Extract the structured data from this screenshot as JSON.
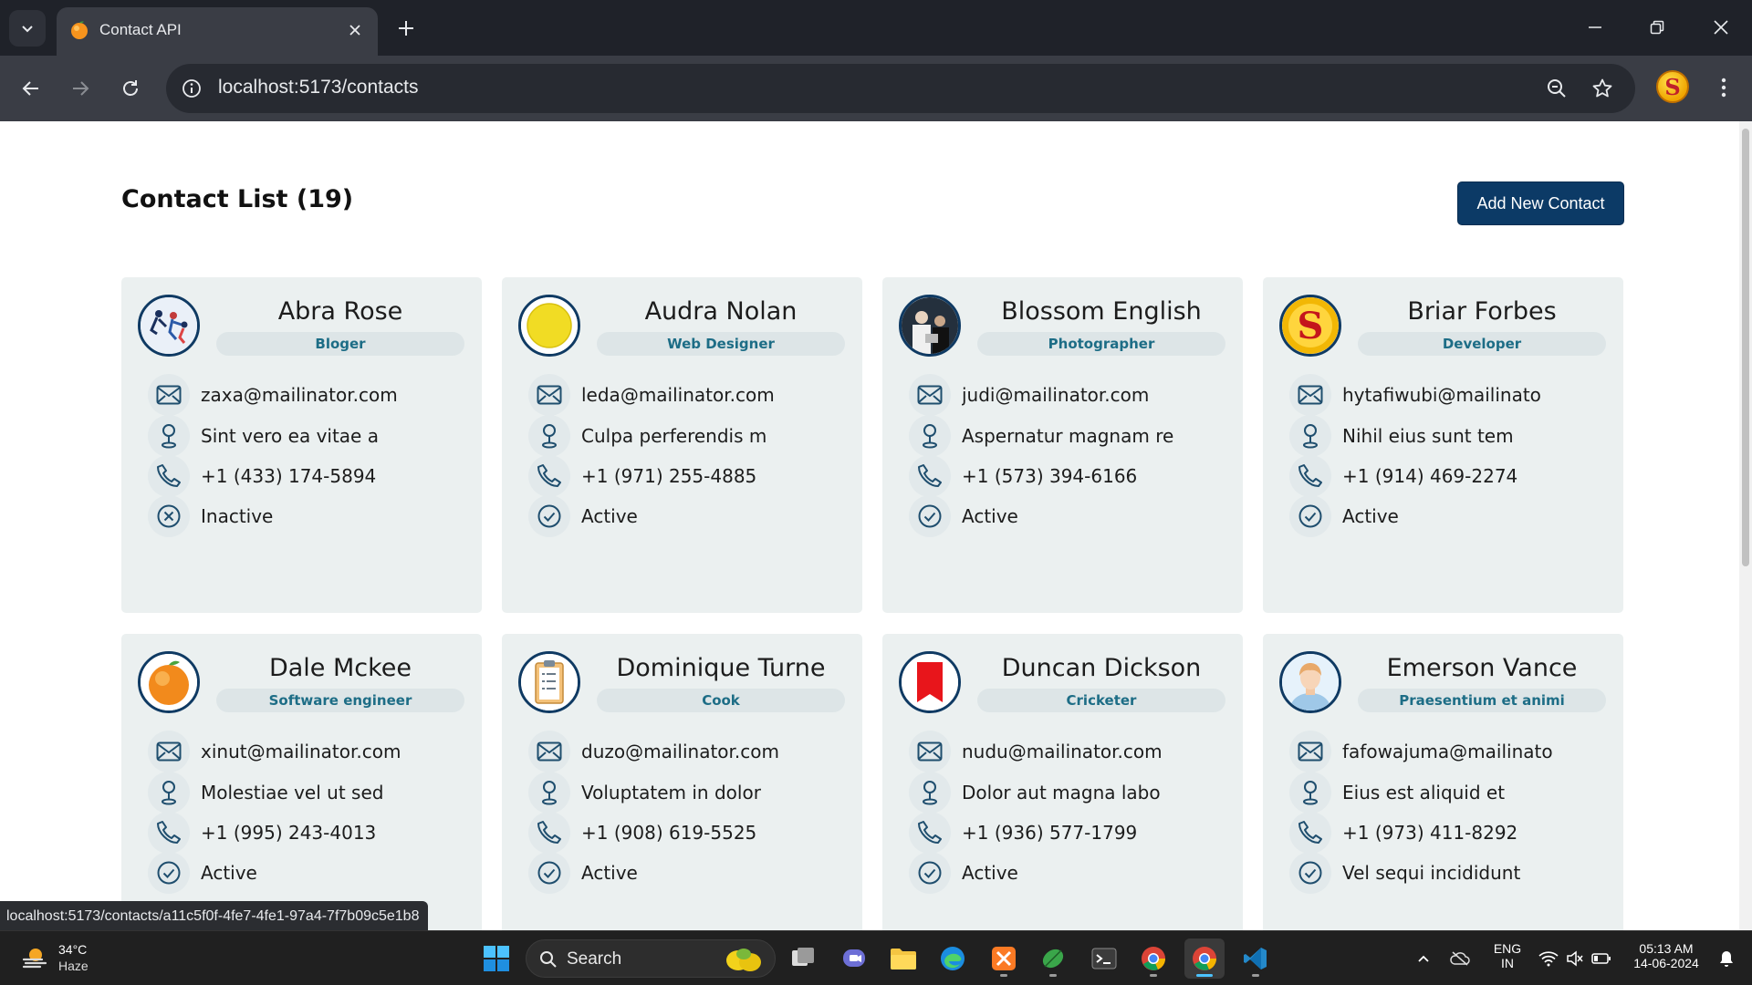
{
  "browser": {
    "tab_title": "Contact API",
    "url": "localhost:5173/contacts",
    "status_url": "localhost:5173/contacts/a11c5f0f-4fe7-4fe1-97a4-7f7b09c5e1b8"
  },
  "page": {
    "title": "Contact List (19)",
    "add_button": "Add New Contact"
  },
  "contacts": [
    {
      "name": "Abra Rose",
      "role": "Bloger",
      "email": "zaxa@mailinator.com",
      "address": "Sint vero ea vitae a",
      "phone": "+1 (433) 174-5894",
      "status": "Inactive",
      "avatar": "runners-photo"
    },
    {
      "name": "Audra Nolan",
      "role": "Web Designer",
      "email": "leda@mailinator.com",
      "address": "Culpa perferendis m",
      "phone": "+1 (971) 255-4885",
      "status": "Active",
      "avatar": "yellow-circle"
    },
    {
      "name": "Blossom English",
      "role": "Photographer",
      "email": "judi@mailinator.com",
      "address": "Aspernatur magnam re",
      "phone": "+1 (573) 394-6166",
      "status": "Active",
      "avatar": "people-photo"
    },
    {
      "name": "Briar Forbes",
      "role": "Developer",
      "email": "hytafiwubi@mailinato",
      "address": "Nihil eius sunt tem",
      "phone": "+1 (914) 469-2274",
      "status": "Active",
      "avatar": "letter-s-logo"
    },
    {
      "name": "Dale Mckee",
      "role": "Software engineer",
      "email": "xinut@mailinator.com",
      "address": "Molestiae vel ut sed",
      "phone": "+1 (995) 243-4013",
      "status": "Active",
      "avatar": "orange-fruit"
    },
    {
      "name": "Dominique Turne",
      "role": "Cook",
      "email": "duzo@mailinator.com",
      "address": "Voluptatem in dolor",
      "phone": "+1 (908) 619-5525",
      "status": "Active",
      "avatar": "clipboard"
    },
    {
      "name": "Duncan Dickson",
      "role": "Cricketer",
      "email": "nudu@mailinator.com",
      "address": "Dolor aut magna labo",
      "phone": "+1 (936) 577-1799",
      "status": "Active",
      "avatar": "red-bookmark"
    },
    {
      "name": "Emerson Vance",
      "role": "Praesentium et animi",
      "email": "fafowajuma@mailinato",
      "address": "Eius est aliquid et",
      "phone": "+1 (973) 411-8292",
      "status": "Vel sequi incididunt",
      "avatar": "person-avatar"
    }
  ],
  "taskbar": {
    "temperature": "34°C",
    "weather": "Haze",
    "search_label": "Search",
    "language": "ENG",
    "region": "IN",
    "time": "05:13 AM",
    "date": "14-06-2024"
  },
  "colors": {
    "accent": "#0c3a66",
    "card_bg": "#ebf0f0",
    "role_text": "#1d6d86",
    "icon_stroke": "#1f4e6e"
  }
}
